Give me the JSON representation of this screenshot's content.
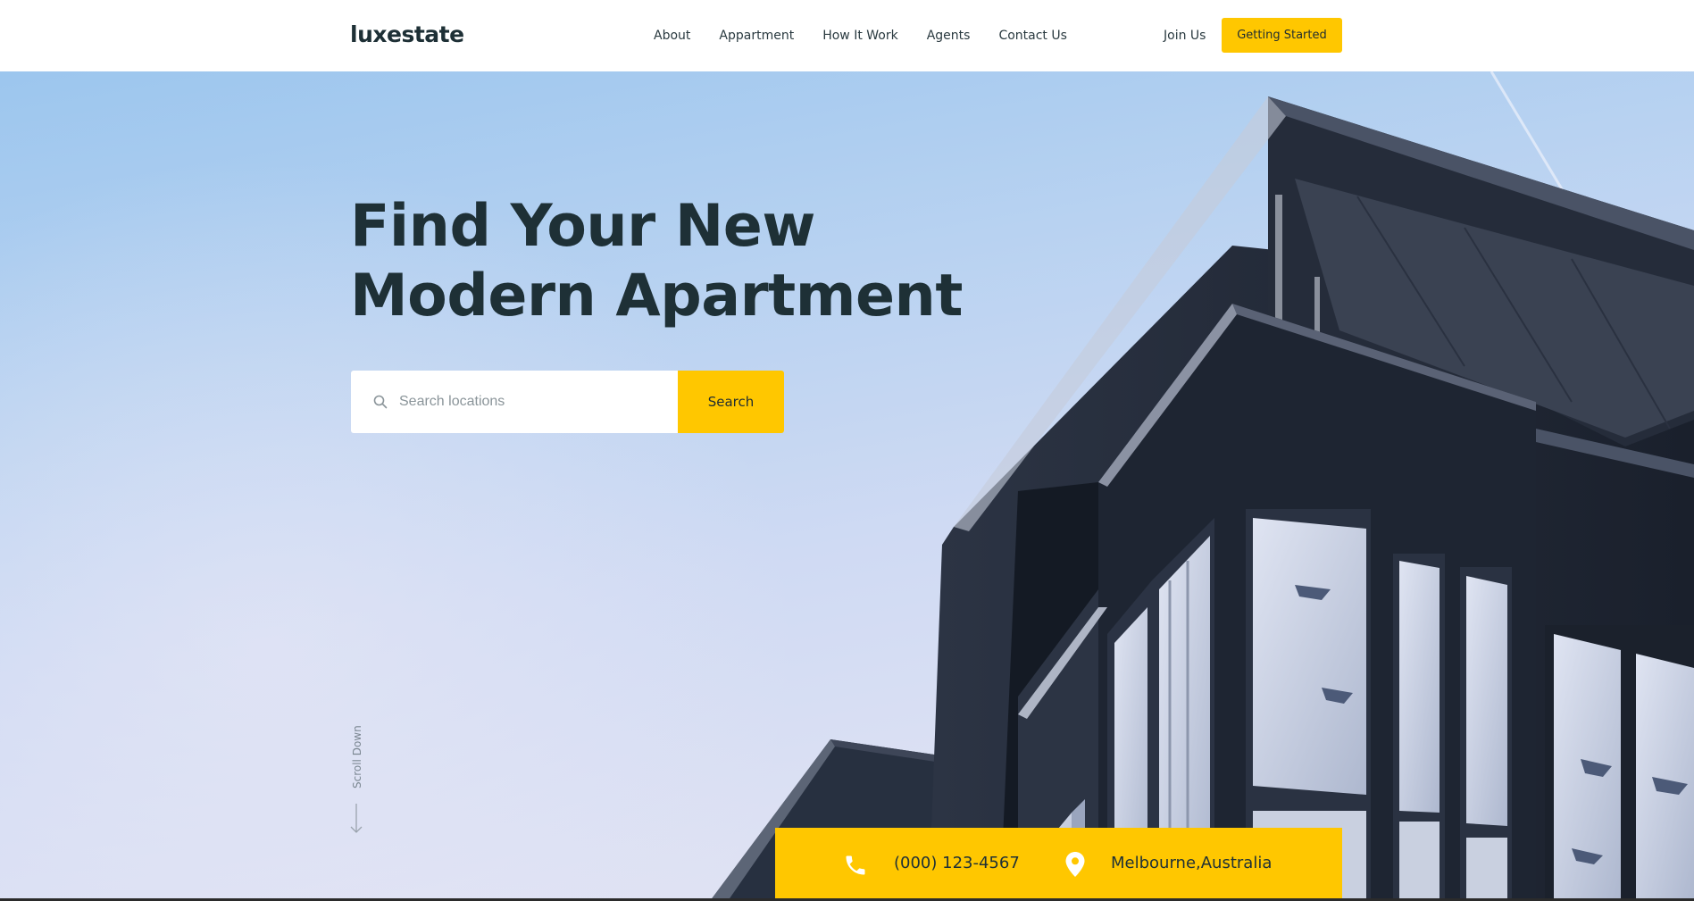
{
  "brand": {
    "logo_text": "luxestate"
  },
  "nav": {
    "items": [
      "About",
      "Appartment",
      "How It Work",
      "Agents",
      "Contact Us"
    ],
    "join_label": "Join Us",
    "cta_label": "Getting Started"
  },
  "hero": {
    "headline_line1": "Find Your New",
    "headline_line2": "Modern Apartment",
    "search": {
      "placeholder": "Search locations",
      "button_label": "Search"
    },
    "scroll_label": "Scroll Down"
  },
  "contact": {
    "phone": "(000) 123-4567",
    "location": "Melbourne,Australia"
  },
  "colors": {
    "accent": "#ffc700",
    "text_dark": "#1e3036",
    "sky": "#b8d2f1",
    "building": "#1f2633"
  },
  "icons": [
    "search-icon",
    "arrow-down-icon",
    "phone-icon",
    "map-pin-icon"
  ]
}
